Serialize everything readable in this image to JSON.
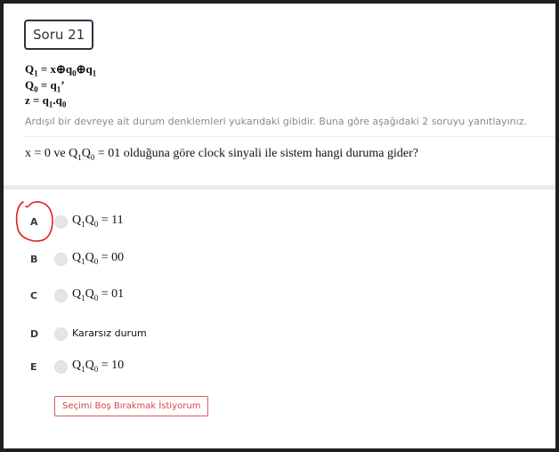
{
  "question_badge": "Soru 21",
  "equations": {
    "line1": {
      "a": "Q",
      "a_sub": "1",
      "rest": " = x⊕q",
      "b_sub": "0",
      "rest2": "⊕q",
      "c_sub": "1"
    },
    "line2": {
      "a": "Q",
      "a_sub": "0",
      "rest": " = q",
      "b_sub": "1",
      "rest2": "’"
    },
    "line3": {
      "a": "z = q",
      "a_sub": "1",
      "rest": ".q",
      "b_sub": "0"
    }
  },
  "intro_text": "Ardışıl bir devreye ait durum denklemleri yukarıdaki gibidir. Buna göre aşağıdaki 2 soruyu yanıtlayınız.",
  "question": {
    "p1": "x = 0  ve Q",
    "s1": "1",
    "p2": "Q",
    "s2": "0",
    "p3": " = 01 olduğuna göre clock sinyali ile sistem hangi duruma gider?"
  },
  "options": [
    {
      "letter": "A",
      "q1": "Q",
      "s1": "1",
      "q2": "Q",
      "s2": "0",
      "val": " = 11"
    },
    {
      "letter": "B",
      "q1": "Q",
      "s1": "1",
      "q2": "Q",
      "s2": "0",
      "val": " = 00"
    },
    {
      "letter": "C",
      "q1": "Q",
      "s1": "1",
      "q2": "Q",
      "s2": "0",
      "val": " = 01"
    },
    {
      "letter": "D",
      "text": "Kararsız durum"
    },
    {
      "letter": "E",
      "q1": "Q",
      "s1": "1",
      "q2": "Q",
      "s2": "0",
      "val": " = 10"
    }
  ],
  "blank_button": "Seçimi Boş Bırakmak İstiyorum",
  "colors": {
    "annotation": "#e02020",
    "blank_button": "#d64545",
    "divider_band": "#e6ebf1"
  }
}
